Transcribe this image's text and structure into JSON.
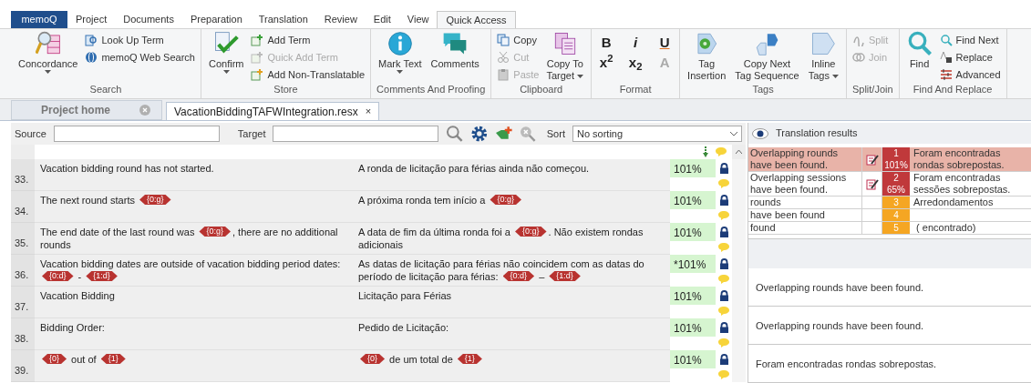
{
  "menu_tabs": [
    {
      "label": "memoQ",
      "kind": "app",
      "selected": false
    },
    {
      "label": "Project",
      "kind": "tab",
      "selected": false
    },
    {
      "label": "Documents",
      "kind": "tab",
      "selected": false
    },
    {
      "label": "Preparation",
      "kind": "tab",
      "selected": false
    },
    {
      "label": "Translation",
      "kind": "tab",
      "selected": false
    },
    {
      "label": "Review",
      "kind": "tab",
      "selected": false
    },
    {
      "label": "Edit",
      "kind": "tab",
      "selected": false
    },
    {
      "label": "View",
      "kind": "tab",
      "selected": false
    },
    {
      "label": "Quick Access",
      "kind": "tab",
      "selected": true
    }
  ],
  "ribbon": [
    {
      "title": "Search",
      "items": [
        {
          "kind": "large",
          "lines": [
            "Concordance"
          ],
          "dropdown": true,
          "disabled": false
        },
        {
          "kind": "small",
          "label": "Look Up Term",
          "disabled": false
        },
        {
          "kind": "small",
          "label": "memoQ Web Search",
          "disabled": false
        }
      ]
    },
    {
      "title": "Store",
      "items": [
        {
          "kind": "large",
          "lines": [
            "Confirm"
          ],
          "dropdown": true,
          "disabled": false
        },
        {
          "kind": "small",
          "label": "Add Term",
          "disabled": false
        },
        {
          "kind": "small",
          "label": "Quick Add Term",
          "disabled": true
        },
        {
          "kind": "small",
          "label": "Add Non-Translatable",
          "disabled": false
        }
      ]
    },
    {
      "title": "Comments And Proofing",
      "items": [
        {
          "kind": "large",
          "lines": [
            "Mark Text"
          ],
          "dropdown": true,
          "disabled": false
        },
        {
          "kind": "large",
          "lines": [
            "Comments"
          ],
          "dropdown": false,
          "disabled": false
        }
      ]
    },
    {
      "title": "Clipboard",
      "items": [
        {
          "kind": "small",
          "label": "Copy",
          "disabled": false
        },
        {
          "kind": "small",
          "label": "Cut",
          "disabled": true
        },
        {
          "kind": "small",
          "label": "Paste",
          "disabled": true
        },
        {
          "kind": "large",
          "lines": [
            "Copy To",
            "Target"
          ],
          "dropdown": true,
          "disabled": false
        }
      ]
    },
    {
      "title": "Format",
      "items": [
        {
          "kind": "format",
          "label": "B",
          "disabled": false
        },
        {
          "kind": "format",
          "label": "i",
          "disabled": false
        },
        {
          "kind": "format",
          "label": "U",
          "disabled": false
        },
        {
          "kind": "format",
          "label": "x$^{2}$",
          "disabled": false
        },
        {
          "kind": "format",
          "label": "x$_{2}$",
          "disabled": false
        },
        {
          "kind": "format",
          "label": "A",
          "disabled": true
        }
      ]
    },
    {
      "title": "Tags",
      "items": [
        {
          "kind": "large",
          "lines": [
            "Tag",
            "Insertion"
          ],
          "dropdown": false,
          "disabled": false
        },
        {
          "kind": "large",
          "lines": [
            "Copy Next",
            "Tag Sequence"
          ],
          "dropdown": false,
          "disabled": false
        },
        {
          "kind": "large",
          "lines": [
            "Inline",
            "Tags"
          ],
          "dropdown": true,
          "disabled": false
        }
      ]
    },
    {
      "title": "Split/Join",
      "items": [
        {
          "kind": "small",
          "label": "Split",
          "disabled": true
        },
        {
          "kind": "small",
          "label": "Join",
          "disabled": true
        }
      ]
    },
    {
      "title": "Find And Replace",
      "items": [
        {
          "kind": "large",
          "lines": [
            "Find"
          ],
          "dropdown": false,
          "disabled": false
        },
        {
          "kind": "small",
          "label": "Find Next",
          "disabled": false
        },
        {
          "kind": "small",
          "label": "Replace",
          "disabled": false
        },
        {
          "kind": "small",
          "label": "Advanced",
          "disabled": false
        }
      ]
    }
  ],
  "doc_tabs": [
    {
      "label": "Project home",
      "kind": "home",
      "selected": false
    },
    {
      "label": "VacationBiddingTAFWIntegration.resx",
      "kind": "document",
      "close": "×",
      "selected": true
    }
  ],
  "filter_bar": {
    "source_label": "Source",
    "target_label": "Target",
    "sort_label": "Sort",
    "sort_value": "No sorting"
  },
  "segments": [
    {
      "number": "33.",
      "source": [
        {
          "kind": "text",
          "text": "Vacation bidding round has not started."
        }
      ],
      "target": [
        {
          "kind": "text",
          "text": "A ronda de licitação para férias ainda não começou."
        }
      ],
      "match": "101%",
      "locked": true
    },
    {
      "number": "34.",
      "source": [
        {
          "kind": "text",
          "text": "The next round starts "
        },
        {
          "kind": "tag",
          "text": "{0:g}"
        }
      ],
      "target": [
        {
          "kind": "text",
          "text": "A próxima ronda tem início a "
        },
        {
          "kind": "tag",
          "text": "{0:g}"
        }
      ],
      "match": "101%",
      "locked": true
    },
    {
      "number": "35.",
      "source": [
        {
          "kind": "text",
          "text": "The end date of the last round was "
        },
        {
          "kind": "tag",
          "text": "{0:g}"
        },
        {
          "kind": "text",
          "text": ", there are no additional rounds"
        }
      ],
      "target": [
        {
          "kind": "text",
          "text": "A data de fim da última ronda foi a "
        },
        {
          "kind": "tag",
          "text": "{0:g}"
        },
        {
          "kind": "text",
          "text": ". Não existem rondas adicionais"
        }
      ],
      "match": "101%",
      "locked": true
    },
    {
      "number": "36.",
      "source": [
        {
          "kind": "text",
          "text": "Vacation bidding dates are outside of vacation bidding period dates: "
        },
        {
          "kind": "tag",
          "text": "{0:d}"
        },
        {
          "kind": "text",
          "text": " - "
        },
        {
          "kind": "tag",
          "text": "{1:d}"
        }
      ],
      "target": [
        {
          "kind": "text",
          "text": "As datas de licitação para férias não coincidem com as datas do período de licitação para férias: "
        },
        {
          "kind": "tag",
          "text": "{0:d}"
        },
        {
          "kind": "text",
          "text": " – "
        },
        {
          "kind": "tag",
          "text": "{1:d}"
        }
      ],
      "match": "*101%",
      "locked": true
    },
    {
      "number": "37.",
      "source": [
        {
          "kind": "text",
          "text": "Vacation Bidding"
        }
      ],
      "target": [
        {
          "kind": "text",
          "text": "Licitação para Férias"
        }
      ],
      "match": "101%",
      "locked": true
    },
    {
      "number": "38.",
      "source": [
        {
          "kind": "text",
          "text": "Bidding Order:"
        }
      ],
      "target": [
        {
          "kind": "text",
          "text": "Pedido de Licitação:"
        }
      ],
      "match": "101%",
      "locked": true
    },
    {
      "number": "39.",
      "source": [
        {
          "kind": "tag",
          "text": "{0}"
        },
        {
          "kind": "text",
          "text": " out of "
        },
        {
          "kind": "tag",
          "text": "{1}"
        }
      ],
      "target": [
        {
          "kind": "tag",
          "text": "{0}"
        },
        {
          "kind": "text",
          "text": " de um total de "
        },
        {
          "kind": "tag",
          "text": "{1}"
        }
      ],
      "match": "101%",
      "locked": true
    }
  ],
  "translation_results": {
    "title": "Translation results",
    "rows": [
      {
        "source": "Overlapping rounds have been found.",
        "edited": true,
        "rank": "1",
        "percent": "101%",
        "target": "Foram encontradas rondas sobrepostas.",
        "color": "#c0393b",
        "selected": true
      },
      {
        "source": "Overlapping sessions have been found.",
        "edited": true,
        "rank": "2",
        "percent": "65%",
        "target": "Foram encontradas sessões sobrepostas.",
        "color": "#c0393b",
        "selected": false
      },
      {
        "source": "rounds",
        "edited": false,
        "rank": "3",
        "target": "Arredondamentos",
        "color": "#f5a623",
        "selected": false
      },
      {
        "source": "have been found",
        "edited": false,
        "rank": "4",
        "color": "#f5a623",
        "selected": false
      },
      {
        "source": "found",
        "edited": false,
        "rank": "5",
        "target": " ( encontrado)",
        "color": "#f5a623",
        "selected": false
      }
    ],
    "details": [
      "Overlapping rounds have been found.",
      "Overlapping rounds have been found.",
      "Foram encontradas rondas sobrepostas."
    ]
  }
}
